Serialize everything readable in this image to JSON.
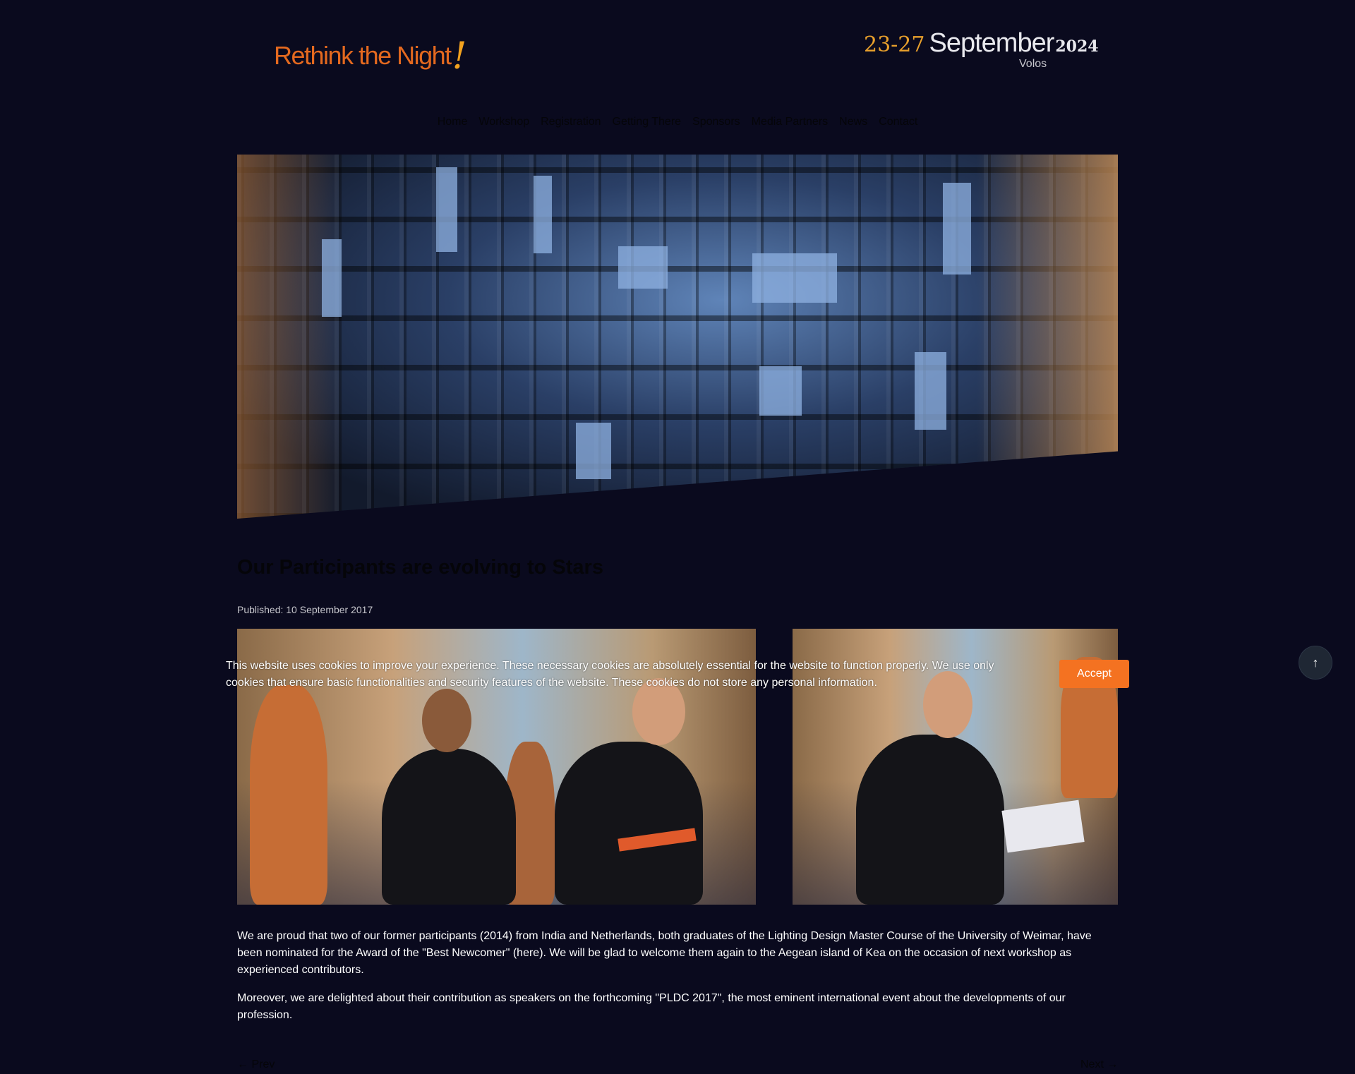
{
  "header": {
    "logo_text": "Rethink the Night",
    "logo_mark": "!",
    "date_range": "23-27",
    "month": "September",
    "year": "2024",
    "city": "Volos"
  },
  "nav": {
    "items": [
      "Home",
      "Workshop",
      "Registration",
      "Getting There",
      "Sponsors",
      "Media Partners",
      "News",
      "Contact"
    ]
  },
  "article": {
    "title": "Our Participants are evolving to Stars",
    "published": "Published: 10 September 2017",
    "paragraphs": [
      "We are proud that two of our former participants (2014) from India and Netherlands, both graduates of the Lighting Design Master Course of the University of Weimar, have been nominated for the Award of the \"Best Newcomer\" (here). We will be glad to welcome them again to the Aegean island of Kea on the occasion of next workshop as experienced contributors.",
      "Moreover, we are delighted about their contribution as speakers on the forthcoming \"PLDC 2017\", the most eminent international event about the developments of our profession."
    ]
  },
  "pager": {
    "prev": "← Prev",
    "next": "Next →"
  },
  "cookie": {
    "message": "This website uses cookies to improve your experience. These necessary cookies are absolutely essential for the website to function properly. We use only cookies that ensure basic functionalities and security features of the website. These cookies do not store any personal information.",
    "accept_label": "Accept"
  },
  "scroll_top_icon": "arrow-up-icon",
  "colors": {
    "background": "#0a0a1e",
    "accent": "#f47221",
    "logo": "#e4691f",
    "date_gold": "#e8a02c"
  }
}
